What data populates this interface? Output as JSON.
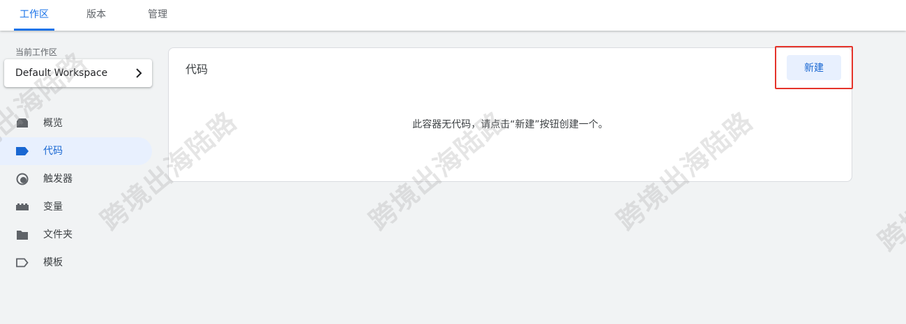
{
  "tabs": [
    {
      "label": "工作区",
      "active": true
    },
    {
      "label": "版本",
      "active": false
    },
    {
      "label": "管理",
      "active": false
    }
  ],
  "sidebar": {
    "workspace_label": "当前工作区",
    "workspace_name": "Default Workspace",
    "items": [
      {
        "label": "概览",
        "icon": "overview-icon",
        "active": false
      },
      {
        "label": "代码",
        "icon": "tag-icon",
        "active": true
      },
      {
        "label": "触发器",
        "icon": "trigger-icon",
        "active": false
      },
      {
        "label": "变量",
        "icon": "variable-icon",
        "active": false
      },
      {
        "label": "文件夹",
        "icon": "folder-icon",
        "active": false
      },
      {
        "label": "模板",
        "icon": "template-icon",
        "active": false
      }
    ]
  },
  "main": {
    "card_title": "代码",
    "new_button_label": "新建",
    "empty_message": "此容器无代码，请点击“新建”按钮创建一个。"
  },
  "watermark": "跨境出海陆路",
  "colors": {
    "accent": "#1a73e8",
    "active_bg": "#e8f0fe",
    "highlight_border": "#e5332a",
    "page_bg": "#f1f3f4"
  }
}
